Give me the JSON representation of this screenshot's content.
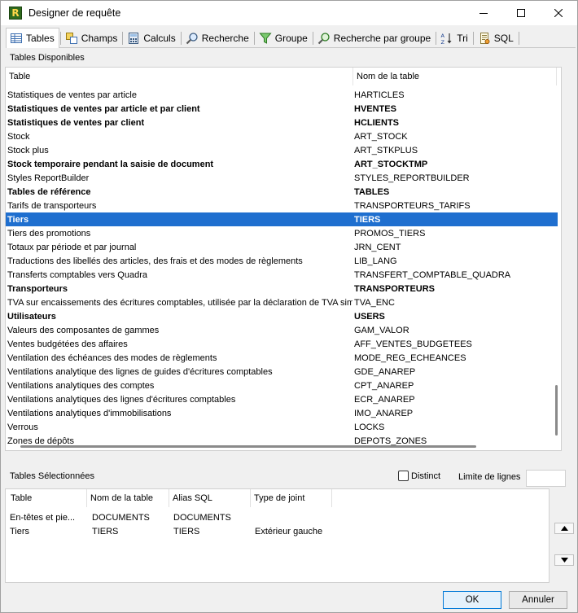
{
  "window": {
    "title": "Designer de requête"
  },
  "tabs": [
    {
      "label": "Tables",
      "icon": "table-icon"
    },
    {
      "label": "Champs",
      "icon": "fields-icon"
    },
    {
      "label": "Calculs",
      "icon": "calculator-icon"
    },
    {
      "label": "Recherche",
      "icon": "magnifier-icon"
    },
    {
      "label": "Groupe",
      "icon": "funnel-icon"
    },
    {
      "label": "Recherche par groupe",
      "icon": "group-search-icon"
    },
    {
      "label": "Tri",
      "icon": "sort-az-icon"
    },
    {
      "label": "SQL",
      "icon": "sql-script-icon"
    }
  ],
  "available": {
    "label": "Tables Disponibles",
    "columns": [
      "Table",
      "Nom de la table"
    ],
    "rows": [
      {
        "table": "Statistiques de ventes par article",
        "name": "HARTICLES",
        "bold": false
      },
      {
        "table": "Statistiques de ventes par article et par client",
        "name": "HVENTES",
        "bold": true
      },
      {
        "table": "Statistiques de ventes par client",
        "name": "HCLIENTS",
        "bold": true
      },
      {
        "table": "Stock",
        "name": "ART_STOCK",
        "bold": false
      },
      {
        "table": "Stock plus",
        "name": "ART_STKPLUS",
        "bold": false
      },
      {
        "table": "Stock temporaire pendant la saisie de document",
        "name": "ART_STOCKTMP",
        "bold": true
      },
      {
        "table": "Styles ReportBuilder",
        "name": "STYLES_REPORTBUILDER",
        "bold": false
      },
      {
        "table": "Tables de référence",
        "name": "TABLES",
        "bold": true
      },
      {
        "table": "Tarifs de transporteurs",
        "name": "TRANSPORTEURS_TARIFS",
        "bold": false
      },
      {
        "table": "Tiers",
        "name": "TIERS",
        "bold": true,
        "selected": true
      },
      {
        "table": "Tiers des promotions",
        "name": "PROMOS_TIERS",
        "bold": false
      },
      {
        "table": "Totaux par période et par journal",
        "name": "JRN_CENT",
        "bold": false
      },
      {
        "table": "Traductions des libellés des articles, des frais et des modes de règlements",
        "name": "LIB_LANG",
        "bold": false
      },
      {
        "table": "Transferts comptables vers Quadra",
        "name": "TRANSFERT_COMPTABLE_QUADRA",
        "bold": false
      },
      {
        "table": "Transporteurs",
        "name": "TRANSPORTEURS",
        "bold": true
      },
      {
        "table": "TVA sur encaissements des écritures comptables, utilisée par la déclaration de TVA simplifiée",
        "name": "TVA_ENC",
        "bold": false
      },
      {
        "table": "Utilisateurs",
        "name": "USERS",
        "bold": true
      },
      {
        "table": "Valeurs des composantes de gammes",
        "name": "GAM_VALOR",
        "bold": false
      },
      {
        "table": "Ventes budgétées des affaires",
        "name": "AFF_VENTES_BUDGETEES",
        "bold": false
      },
      {
        "table": "Ventilation des échéances des modes de règlements",
        "name": "MODE_REG_ECHEANCES",
        "bold": false
      },
      {
        "table": "Ventilations analytique des lignes de guides d'écritures comptables",
        "name": "GDE_ANAREP",
        "bold": false
      },
      {
        "table": "Ventilations analytiques des comptes",
        "name": "CPT_ANAREP",
        "bold": false
      },
      {
        "table": "Ventilations analytiques des lignes d'écritures comptables",
        "name": "ECR_ANAREP",
        "bold": false
      },
      {
        "table": "Ventilations analytiques d'immobilisations",
        "name": "IMO_ANAREP",
        "bold": false
      },
      {
        "table": "Verrous",
        "name": "LOCKS",
        "bold": false
      },
      {
        "table": "Zones de dépôts",
        "name": "DEPOTS_ZONES",
        "bold": false
      }
    ]
  },
  "selected_section": {
    "label": "Tables Sélectionnées",
    "distinct_label": "Distinct",
    "distinct_checked": false,
    "limit_label": "Limite de lignes",
    "limit_value": "",
    "columns": [
      "Table",
      "Nom de la table",
      "Alias SQL",
      "Type de joint"
    ],
    "rows": [
      {
        "table": "En-têtes et pie...",
        "name": "DOCUMENTS",
        "alias": "DOCUMENTS",
        "join": ""
      },
      {
        "table": "Tiers",
        "name": "TIERS",
        "alias": "TIERS",
        "join": "Extérieur gauche"
      }
    ]
  },
  "buttons": {
    "ok": "OK",
    "cancel": "Annuler"
  }
}
